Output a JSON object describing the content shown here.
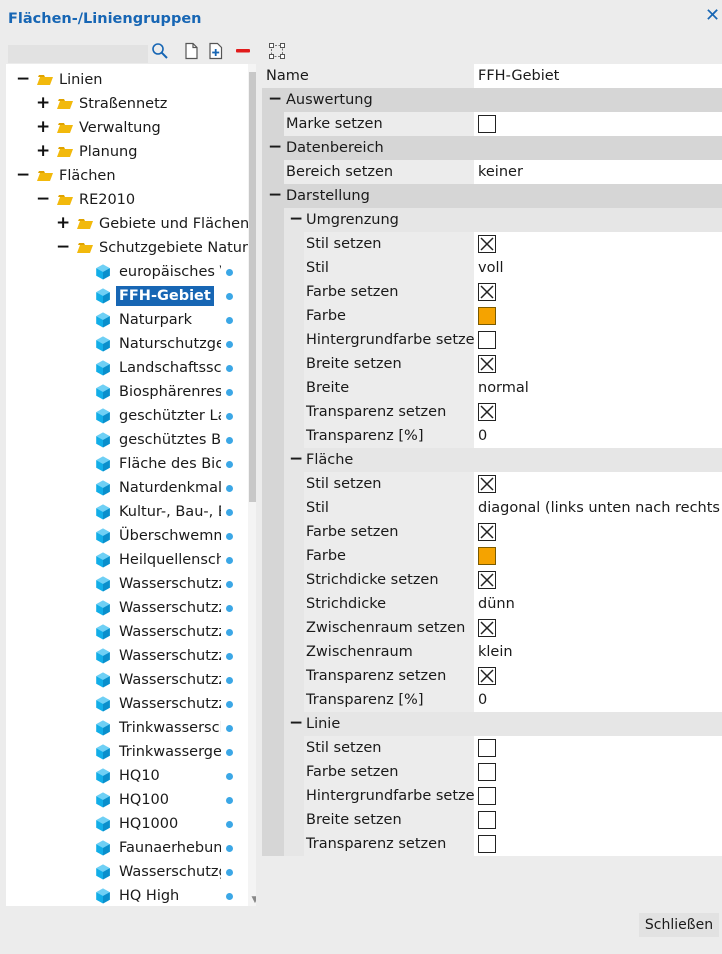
{
  "window": {
    "title": "Flächen-/Liniengruppen",
    "close_glyph": "✕"
  },
  "toolbar": {
    "icons": [
      "search-icon",
      "new-document-icon",
      "add-icon",
      "remove-icon",
      "select-frame-icon"
    ]
  },
  "tree": {
    "items": [
      {
        "label": "Linien",
        "level": 0,
        "expander": "−",
        "icon": "folder"
      },
      {
        "label": "Straßennetz",
        "level": 1,
        "expander": "+",
        "icon": "folder"
      },
      {
        "label": "Verwaltung",
        "level": 1,
        "expander": "+",
        "icon": "folder"
      },
      {
        "label": "Planung",
        "level": 1,
        "expander": "+",
        "icon": "folder"
      },
      {
        "label": "Flächen",
        "level": 0,
        "expander": "−",
        "icon": "folder"
      },
      {
        "label": "RE2010",
        "level": 1,
        "expander": "−",
        "icon": "folder"
      },
      {
        "label": "Gebiete und Flächen",
        "level": 2,
        "expander": "+",
        "icon": "folder"
      },
      {
        "label": "Schutzgebiete Natur,",
        "level": 2,
        "expander": "−",
        "icon": "folder"
      },
      {
        "label": "europäisches Ve",
        "level": 3,
        "icon": "hex"
      },
      {
        "label": "FFH-Gebiet",
        "level": 3,
        "icon": "hex",
        "selected": true
      },
      {
        "label": "Naturpark",
        "level": 3,
        "icon": "hex"
      },
      {
        "label": "Naturschutzgeb",
        "level": 3,
        "icon": "hex"
      },
      {
        "label": "Landschaftsschu",
        "level": 3,
        "icon": "hex"
      },
      {
        "label": "Biosphärenrese",
        "level": 3,
        "icon": "hex"
      },
      {
        "label": "geschützter Lar",
        "level": 3,
        "icon": "hex"
      },
      {
        "label": "geschütztes Bio",
        "level": 3,
        "icon": "hex"
      },
      {
        "label": "Fläche des Biot",
        "level": 3,
        "icon": "hex"
      },
      {
        "label": "Naturdenkmal",
        "level": 3,
        "icon": "hex"
      },
      {
        "label": "Kultur-, Bau-, Bo",
        "level": 3,
        "icon": "hex"
      },
      {
        "label": "Überschwemmu",
        "level": 3,
        "icon": "hex"
      },
      {
        "label": "Heilquellenschu",
        "level": 3,
        "icon": "hex"
      },
      {
        "label": "Wasserschutzzc",
        "level": 3,
        "icon": "hex"
      },
      {
        "label": "Wasserschutzzc",
        "level": 3,
        "icon": "hex"
      },
      {
        "label": "Wasserschutzzc",
        "level": 3,
        "icon": "hex"
      },
      {
        "label": "Wasserschutzzc",
        "level": 3,
        "icon": "hex"
      },
      {
        "label": "Wasserschutzzc",
        "level": 3,
        "icon": "hex"
      },
      {
        "label": "Wasserschutzzc",
        "level": 3,
        "icon": "hex"
      },
      {
        "label": "Trinkwasserschu",
        "level": 3,
        "icon": "hex"
      },
      {
        "label": "Trinkwassergew",
        "level": 3,
        "icon": "hex"
      },
      {
        "label": "HQ10",
        "level": 3,
        "icon": "hex"
      },
      {
        "label": "HQ100",
        "level": 3,
        "icon": "hex"
      },
      {
        "label": "HQ1000",
        "level": 3,
        "icon": "hex"
      },
      {
        "label": "Faunaerhebung",
        "level": 3,
        "icon": "hex"
      },
      {
        "label": "Wasserschutzge",
        "level": 3,
        "icon": "hex"
      },
      {
        "label": "HQ High",
        "level": 3,
        "icon": "hex"
      }
    ]
  },
  "properties": {
    "rows": [
      {
        "kind": "plain",
        "label": "Name",
        "type": "text",
        "value": "FFH-Gebiet"
      },
      {
        "kind": "category",
        "label": "Auswertung"
      },
      {
        "kind": "leaf",
        "depth": 1,
        "label": "Marke setzen",
        "type": "check",
        "checked": false
      },
      {
        "kind": "category",
        "label": "Datenbereich"
      },
      {
        "kind": "leaf",
        "depth": 1,
        "label": "Bereich setzen",
        "type": "text",
        "value": "keiner"
      },
      {
        "kind": "category",
        "label": "Darstellung"
      },
      {
        "kind": "subcategory",
        "label": "Umgrenzung"
      },
      {
        "kind": "leaf",
        "depth": 2,
        "label": "Stil setzen",
        "type": "check",
        "checked": true
      },
      {
        "kind": "leaf",
        "depth": 2,
        "label": "Stil",
        "type": "text",
        "value": "voll"
      },
      {
        "kind": "leaf",
        "depth": 2,
        "label": "Farbe setzen",
        "type": "check",
        "checked": true
      },
      {
        "kind": "leaf",
        "depth": 2,
        "label": "Farbe",
        "type": "color",
        "color": "#f5a300"
      },
      {
        "kind": "leaf",
        "depth": 2,
        "label": "Hintergrundfarbe setzen",
        "type": "check",
        "checked": false
      },
      {
        "kind": "leaf",
        "depth": 2,
        "label": "Breite setzen",
        "type": "check",
        "checked": true
      },
      {
        "kind": "leaf",
        "depth": 2,
        "label": "Breite",
        "type": "text",
        "value": "normal"
      },
      {
        "kind": "leaf",
        "depth": 2,
        "label": "Transparenz setzen",
        "type": "check",
        "checked": true
      },
      {
        "kind": "leaf",
        "depth": 2,
        "label": "Transparenz [%]",
        "type": "text",
        "value": "0"
      },
      {
        "kind": "subcategory",
        "label": "Fläche"
      },
      {
        "kind": "leaf",
        "depth": 2,
        "label": "Stil setzen",
        "type": "check",
        "checked": true
      },
      {
        "kind": "leaf",
        "depth": 2,
        "label": "Stil",
        "type": "text",
        "value": "diagonal (links unten nach rechts oben)"
      },
      {
        "kind": "leaf",
        "depth": 2,
        "label": "Farbe setzen",
        "type": "check",
        "checked": true
      },
      {
        "kind": "leaf",
        "depth": 2,
        "label": "Farbe",
        "type": "color",
        "color": "#f5a300"
      },
      {
        "kind": "leaf",
        "depth": 2,
        "label": "Strichdicke setzen",
        "type": "check",
        "checked": true
      },
      {
        "kind": "leaf",
        "depth": 2,
        "label": "Strichdicke",
        "type": "text",
        "value": "dünn"
      },
      {
        "kind": "leaf",
        "depth": 2,
        "label": "Zwischenraum setzen",
        "type": "check",
        "checked": true
      },
      {
        "kind": "leaf",
        "depth": 2,
        "label": "Zwischenraum",
        "type": "text",
        "value": "klein"
      },
      {
        "kind": "leaf",
        "depth": 2,
        "label": "Transparenz setzen",
        "type": "check",
        "checked": true
      },
      {
        "kind": "leaf",
        "depth": 2,
        "label": "Transparenz [%]",
        "type": "text",
        "value": "0"
      },
      {
        "kind": "subcategory",
        "label": "Linie"
      },
      {
        "kind": "leaf",
        "depth": 2,
        "label": "Stil setzen",
        "type": "check",
        "checked": false
      },
      {
        "kind": "leaf",
        "depth": 2,
        "label": "Farbe setzen",
        "type": "check",
        "checked": false
      },
      {
        "kind": "leaf",
        "depth": 2,
        "label": "Hintergrundfarbe setzen",
        "type": "check",
        "checked": false
      },
      {
        "kind": "leaf",
        "depth": 2,
        "label": "Breite setzen",
        "type": "check",
        "checked": false
      },
      {
        "kind": "leaf",
        "depth": 2,
        "label": "Transparenz setzen",
        "type": "check",
        "checked": false
      }
    ]
  },
  "footer": {
    "close_button": "Schließen"
  },
  "colors": {
    "accent": "#1766b4",
    "folder": "#f2b90c",
    "hex": "#12aee8",
    "dot": "#3ba7e6",
    "remove": "#e11b1b"
  }
}
